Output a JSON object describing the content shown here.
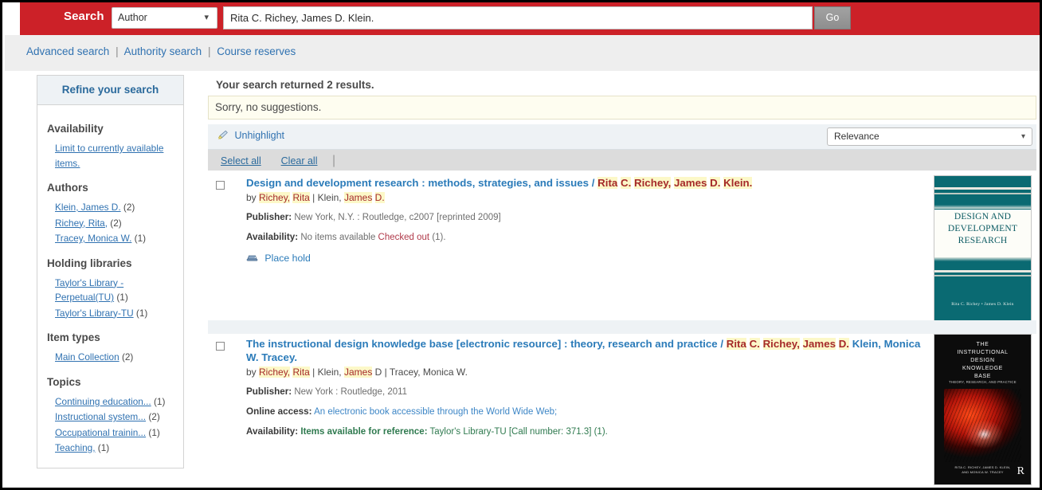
{
  "header": {
    "search_label": "Search",
    "index_selected": "Author",
    "query_value": "Rita C. Richey, James D. Klein.",
    "query_placeholder": "",
    "go_label": "Go"
  },
  "subnav": {
    "items": [
      "Advanced search",
      "Authority search",
      "Course reserves"
    ],
    "separator": "|"
  },
  "sidebar": {
    "title": "Refine your search",
    "groups": [
      {
        "title": "Availability",
        "items": [
          {
            "label": "Limit to currently available items.",
            "count": ""
          }
        ]
      },
      {
        "title": "Authors",
        "items": [
          {
            "label": "Klein, James D.",
            "count": "(2)"
          },
          {
            "label": "Richey, Rita,",
            "count": "(2)"
          },
          {
            "label": "Tracey, Monica W.",
            "count": "(1)"
          }
        ]
      },
      {
        "title": "Holding libraries",
        "items": [
          {
            "label": "Taylor's Library - Perpetual(TU)",
            "count": "(1)"
          },
          {
            "label": "Taylor's Library-TU",
            "count": "(1)"
          }
        ]
      },
      {
        "title": "Item types",
        "items": [
          {
            "label": "Main Collection",
            "count": "(2)"
          }
        ]
      },
      {
        "title": "Topics",
        "items": [
          {
            "label": "Continuing education...",
            "count": "(1)"
          },
          {
            "label": "Instructional system...",
            "count": "(2)"
          },
          {
            "label": "Occupational trainin...",
            "count": "(1)"
          },
          {
            "label": "Teaching,",
            "count": "(1)"
          }
        ]
      }
    ]
  },
  "results_header": {
    "summary": "Your search returned 2 results.",
    "suggestion": "Sorry, no suggestions.",
    "unhighlight_label": "Unhighlight",
    "unhighlight_icon": "highlighter-icon",
    "sort_selected": "Relevance",
    "select_all_label": "Select all",
    "clear_all_label": "Clear all"
  },
  "results": [
    {
      "title_plain": "Design and development research : methods, strategies, and issues / ",
      "title_highlights": [
        "Rita",
        "C.",
        "Richey,",
        "James",
        "D.",
        "Klein."
      ],
      "by_label": "by ",
      "byline_parts": [
        "Richey,",
        "Rita",
        " | Klein,",
        "James",
        "D."
      ],
      "publisher_label": "Publisher:",
      "publisher_value": "New York, N.Y. : Routledge, c2007 [reprinted 2009]",
      "availability_label": "Availability:",
      "availability_prefix": "No items available ",
      "availability_status": "Checked out",
      "availability_count": "(1).",
      "place_hold_label": "Place hold",
      "place_hold_icon": "hold-icon",
      "cover": {
        "title_lines": [
          "DESIGN AND",
          "DEVELOPMENT",
          "RESEARCH"
        ],
        "authors": "Rita C. Richey • James D. Klein"
      }
    },
    {
      "title_plain": "The instructional design knowledge base [electronic resource] : theory, research and practice / ",
      "title_highlights": [
        "Rita",
        "C.",
        "Richey,",
        "James",
        "D."
      ],
      "title_tail": " Klein, Monica W. Tracey.",
      "by_label": "by ",
      "byline_parts": [
        "Richey,",
        "Rita",
        " | Klein,",
        "James",
        "D | Tracey, Monica W."
      ],
      "publisher_label": "Publisher:",
      "publisher_value": "New York : Routledge, 2011",
      "online_label": "Online access:",
      "online_value": "An electronic book accessible through the World Wide Web;",
      "availability_label": "Availability:",
      "availability_status": "Items available for reference:",
      "availability_value": " Taylor's Library-TU [Call number: 371.3] (1).",
      "cover": {
        "title_lines": [
          "THE",
          "INSTRUCTIONAL",
          "DESIGN",
          "KNOWLEDGE",
          "BASE"
        ],
        "subtitle": "THEORY, RESEARCH, AND PRACTICE",
        "authors_lines": [
          "RITA C. RICHEY, JAMES D. KLEIN,",
          "AND MONICA W. TRACEY"
        ],
        "publisher_mark": "R"
      }
    }
  ],
  "colors": {
    "brand_red": "#cc2128",
    "link_blue": "#3072b1",
    "title_blue": "#2b7bb9",
    "highlight_bg": "#fcf8c8",
    "highlight_fg": "#a52a2a",
    "checked_out": "#b03a4a",
    "available_green": "#2f7a4f",
    "toolbar_bg": "#eef2f5",
    "selectbar_bg": "#dcdcdc"
  }
}
